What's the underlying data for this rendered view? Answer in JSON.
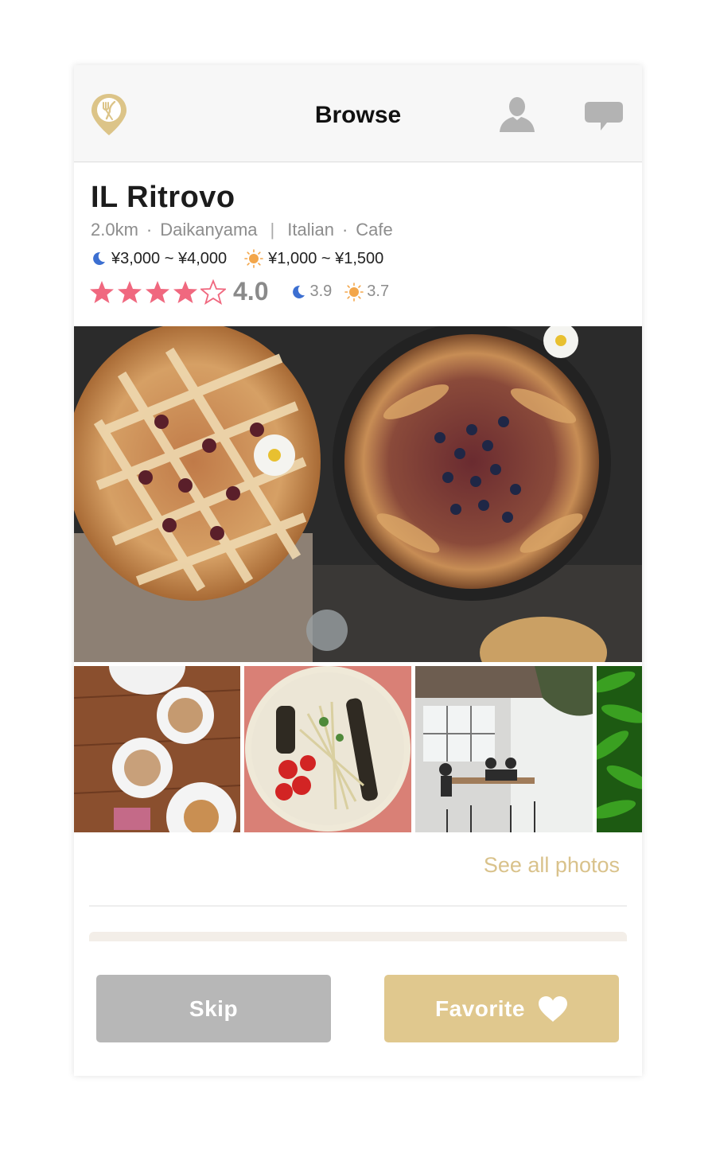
{
  "header": {
    "title": "Browse",
    "icons": [
      "app-logo-icon",
      "profile-icon",
      "chat-icon"
    ]
  },
  "restaurant": {
    "name": "IL Ritrovo",
    "distance": "2.0km",
    "area": "Daikanyama",
    "category1": "Italian",
    "category2": "Cafe",
    "separator": "·",
    "divider": "|",
    "dinner_price": "¥3,000 ~ ¥4,000",
    "lunch_price": "¥1,000 ~ ¥1,500",
    "rating": "4.0",
    "stars_filled": 4,
    "stars_total": 5,
    "dinner_rating": "3.9",
    "lunch_rating": "3.7"
  },
  "photos": {
    "hero": "pies",
    "thumbnails": [
      "coffee",
      "salad",
      "interior",
      "peppers"
    ],
    "see_all_label": "See all photos"
  },
  "actions": {
    "skip_label": "Skip",
    "favorite_label": "Favorite"
  },
  "colors": {
    "accent": "#e0c88e",
    "star": "#f0687f",
    "skip": "#b7b7b7",
    "moon": "#3c6fd1",
    "sun": "#f3a64a"
  }
}
